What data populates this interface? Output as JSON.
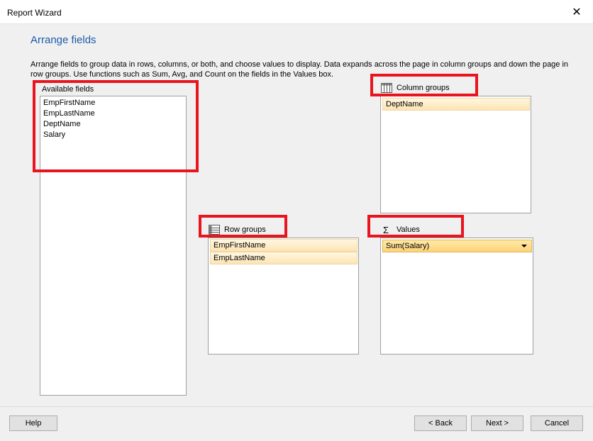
{
  "window": {
    "title": "Report Wizard",
    "close_glyph": "✕"
  },
  "page": {
    "heading": "Arrange fields",
    "description": "Arrange fields to group data in rows, columns, or both, and choose values to display. Data expands across the page in column groups and down the page in row groups.  Use functions such as Sum, Avg, and Count on the fields in the Values box."
  },
  "available_fields": {
    "label": "Available fields",
    "items": [
      "EmpFirstName",
      "EmpLastName",
      "DeptName",
      "Salary"
    ]
  },
  "column_groups": {
    "label": "Column groups",
    "icon": "column-groups-icon",
    "items": [
      "DeptName"
    ]
  },
  "row_groups": {
    "label": "Row groups",
    "icon": "row-groups-icon",
    "items": [
      "EmpFirstName",
      "EmpLastName"
    ]
  },
  "values": {
    "label": "Values",
    "icon": "sigma-icon",
    "icon_glyph": "Σ",
    "items": [
      "Sum(Salary)"
    ]
  },
  "buttons": {
    "help": "Help",
    "back": "< Back",
    "next": "Next >",
    "cancel": "Cancel"
  },
  "colors": {
    "highlight_box": "#e8141e",
    "heading": "#1e5aa8"
  }
}
